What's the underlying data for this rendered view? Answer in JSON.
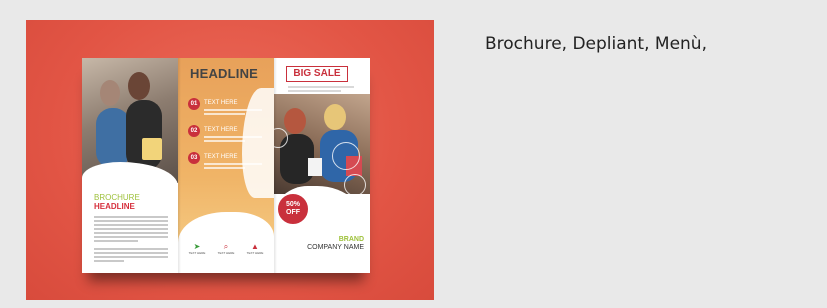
{
  "caption": "Brochure, Depliant, Menù,",
  "brochure": {
    "headline": "HEADLINE",
    "big_sale": "BIG SALE",
    "items": [
      {
        "num": "01",
        "text": "TEXT HERE"
      },
      {
        "num": "02",
        "text": "TEXT HERE"
      },
      {
        "num": "03",
        "text": "TEXT HERE"
      }
    ],
    "cover_title_1": "BROCHURE",
    "cover_title_2": "HEADLINE",
    "discount_1": "50%",
    "discount_2": "OFF",
    "brand": "BRAND",
    "company": "COMPANY NAME",
    "footer_icons": [
      {
        "icon": "paper-plane-icon",
        "label": "TEXT HERE"
      },
      {
        "icon": "search-icon",
        "label": "TEXT HERE"
      },
      {
        "icon": "person-icon",
        "label": "TEXT HERE"
      }
    ]
  },
  "colors": {
    "background": "#e9e9e9",
    "card": "#e25545",
    "accent_red": "#c9303c",
    "accent_green": "#9ec13b",
    "orange": "#f0b467"
  }
}
